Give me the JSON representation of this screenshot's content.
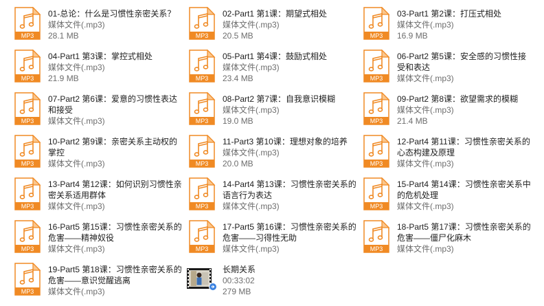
{
  "files": [
    {
      "name": "01-总论：什么是习惯性亲密关系？",
      "type": "媒体文件(.mp3)",
      "size": "28.1 MB",
      "icon": "mp3-file-icon"
    },
    {
      "name": "02-Part1 第1课：期望式相处",
      "type": "媒体文件(.mp3)",
      "size": "20.5 MB",
      "icon": "mp3-file-icon"
    },
    {
      "name": "03-Part1 第2课：打压式相处",
      "type": "媒体文件(.mp3)",
      "size": "16.9 MB",
      "icon": "mp3-file-icon"
    },
    {
      "name": "04-Part1 第3课：掌控式相处",
      "type": "媒体文件(.mp3)",
      "size": "21.9 MB",
      "icon": "mp3-file-icon"
    },
    {
      "name": "05-Part1 第4课：鼓励式相处",
      "type": "媒体文件(.mp3)",
      "size": "23.4 MB",
      "icon": "mp3-file-icon"
    },
    {
      "name": "06-Part2 第5课：安全感的习惯性接受和表达",
      "type": "媒体文件(.mp3)",
      "size": "",
      "icon": "mp3-file-icon"
    },
    {
      "name": "07-Part2 第6课：爱意的习惯性表达和接受",
      "type": "媒体文件(.mp3)",
      "size": "",
      "icon": "mp3-file-icon"
    },
    {
      "name": "08-Part2 第7课：自我意识模糊",
      "type": "媒体文件(.mp3)",
      "size": "19.0 MB",
      "icon": "mp3-file-icon"
    },
    {
      "name": "09-Part2 第8课：欲望需求的模糊",
      "type": "媒体文件(.mp3)",
      "size": "21.4 MB",
      "icon": "mp3-file-icon"
    },
    {
      "name": "10-Part2 第9课：亲密关系主动权的掌控",
      "type": "媒体文件(.mp3)",
      "size": "",
      "icon": "mp3-file-icon"
    },
    {
      "name": "11-Part3 第10课：理想对象的培养",
      "type": "媒体文件(.mp3)",
      "size": "20.0 MB",
      "icon": "mp3-file-icon"
    },
    {
      "name": "12-Part4 第11课：习惯性亲密关系的心态构建及原理",
      "type": "媒体文件(.mp3)",
      "size": "",
      "icon": "mp3-file-icon"
    },
    {
      "name": "13-Part4 第12课：如何识别习惯性亲密关系适用群体",
      "type": "媒体文件(.mp3)",
      "size": "",
      "icon": "mp3-file-icon"
    },
    {
      "name": "14-Part4 第13课：习惯性亲密关系的语言行为表达",
      "type": "媒体文件(.mp3)",
      "size": "",
      "icon": "mp3-file-icon"
    },
    {
      "name": "15-Part4 第14课：习惯性亲密关系中的危机处理",
      "type": "媒体文件(.mp3)",
      "size": "",
      "icon": "mp3-file-icon"
    },
    {
      "name": "16-Part5 第15课：习惯性亲密关系的危害——精神奴役",
      "type": "媒体文件(.mp3)",
      "size": "",
      "icon": "mp3-file-icon"
    },
    {
      "name": "17-Part5 第16课：习惯性亲密关系的危害——习得性无助",
      "type": "媒体文件(.mp3)",
      "size": "",
      "icon": "mp3-file-icon"
    },
    {
      "name": "18-Part5 第17课：习惯性亲密关系的危害——僵尸化麻木",
      "type": "媒体文件(.mp3)",
      "size": "",
      "icon": "mp3-file-icon"
    },
    {
      "name": "19-Part5 第18课：习惯性亲密关系的危害——意识觉醒逃离",
      "type": "媒体文件(.mp3)",
      "size": "",
      "icon": "mp3-file-icon"
    },
    {
      "name": "长期关系",
      "type": "00:33:02",
      "size": "279 MB",
      "icon": "video-thumbnail-icon"
    }
  ],
  "mp3_badge": "MP3",
  "colors": {
    "icon_orange": "#f08a24",
    "page_fold": "#fbc68c",
    "name_text": "#1e1e1e",
    "meta_text": "#6d6d6d"
  }
}
